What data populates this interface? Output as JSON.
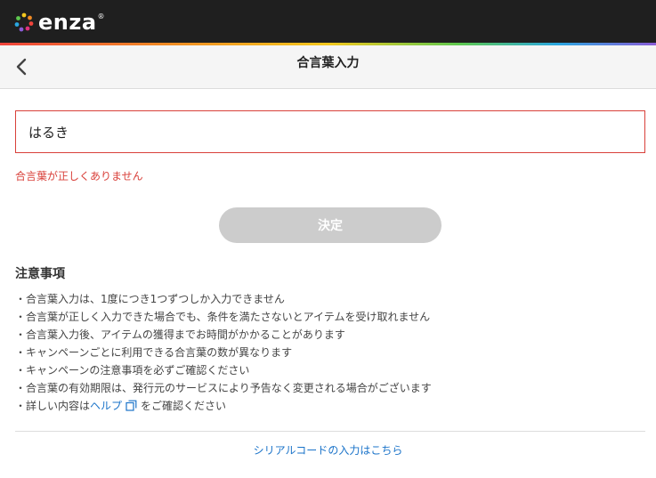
{
  "header": {
    "logo_text": "enza",
    "logo_reg": "®"
  },
  "nav": {
    "title": "合言葉入力"
  },
  "form": {
    "input_value": "はるき",
    "error": "合言葉が正しくありません",
    "submit_label": "決定"
  },
  "notes": {
    "heading": "注意事項",
    "items": [
      "合言葉入力は、1度につき1つずつしか入力できません",
      "合言葉が正しく入力できた場合でも、条件を満たさないとアイテムを受け取れません",
      "合言葉入力後、アイテムの獲得までお時間がかかることがあります",
      "キャンペーンごとに利用できる合言葉の数が異なります",
      "キャンペーンの注意事項を必ずご確認ください",
      "合言葉の有効期限は、発行元のサービスにより予告なく変更される場合がございます"
    ],
    "last_prefix": "詳しい内容は",
    "help_link": "ヘルプ",
    "last_suffix": "をご確認ください"
  },
  "footer": {
    "serial_link": "シリアルコードの入力はこちら"
  },
  "colors": {
    "error": "#d9403a",
    "link": "#1a73c9",
    "disabled_button": "#cccccc"
  }
}
